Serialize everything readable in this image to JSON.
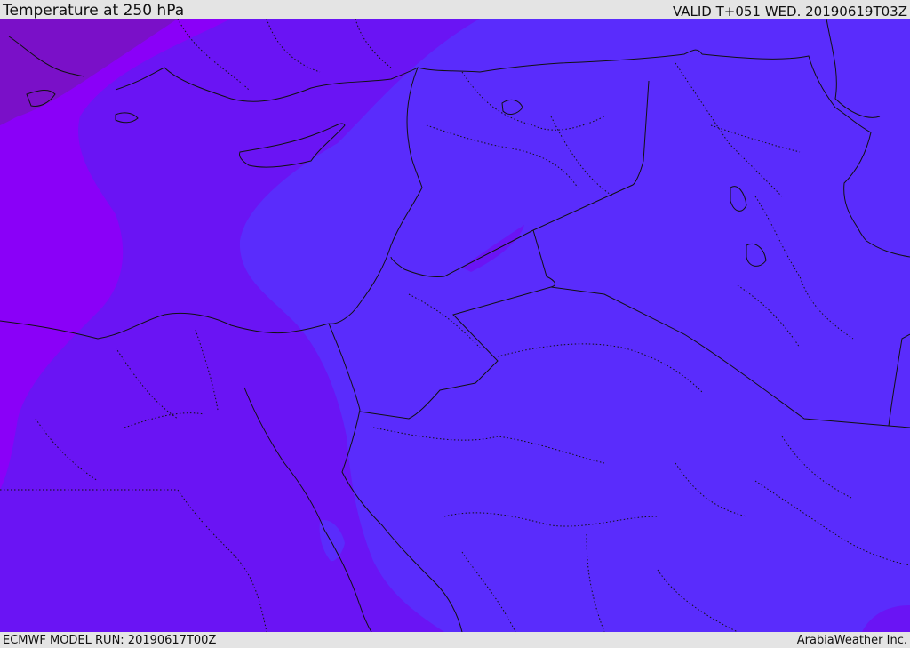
{
  "header": {
    "title": "Temperature at 250 hPa",
    "valid": "VALID T+051 WED. 20190619T03Z"
  },
  "footer": {
    "model_run": "ECMWF MODEL RUN: 20190617T00Z",
    "credit": "ArabiaWeather Inc."
  },
  "map": {
    "field": "temperature",
    "level": "250 hPa",
    "colors": {
      "coldest": "#7a10c8",
      "colder": "#8a00f8",
      "cold": "#6a14f4",
      "mild": "#5a2cfc",
      "border_line": "#111111"
    }
  }
}
